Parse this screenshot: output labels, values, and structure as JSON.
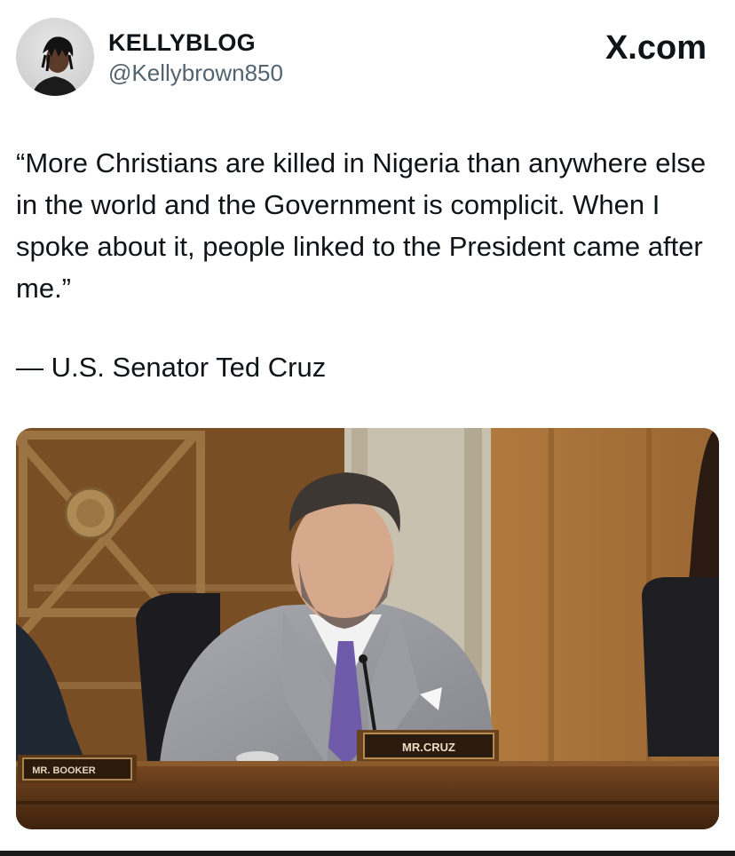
{
  "author": {
    "display_name": "KELLYBLOG",
    "handle": "@Kellybrown850"
  },
  "source_logo": "X.com",
  "tweet": {
    "text": "“More Christians are killed in Nigeria than anywhere else in the world and the Government is complicit. When I spoke about it, people linked to the President came after me.”",
    "attribution": "— U.S. Senator Ted Cruz"
  },
  "media": {
    "nameplate_center": "MR.CRUZ",
    "nameplate_left": "MR. BOOKER"
  }
}
